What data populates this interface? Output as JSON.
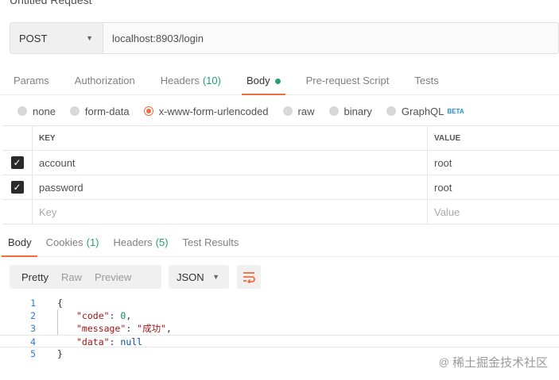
{
  "window": {
    "title": "Untitled Request"
  },
  "request": {
    "method": "POST",
    "url": "localhost:8903/login"
  },
  "request_tabs": [
    {
      "label": "Params"
    },
    {
      "label": "Authorization"
    },
    {
      "label": "Headers",
      "count": "(10)"
    },
    {
      "label": "Body"
    },
    {
      "label": "Pre-request Script"
    },
    {
      "label": "Tests"
    }
  ],
  "body_types": [
    {
      "label": "none"
    },
    {
      "label": "form-data"
    },
    {
      "label": "x-www-form-urlencoded",
      "selected": true
    },
    {
      "label": "raw"
    },
    {
      "label": "binary"
    },
    {
      "label": "GraphQL",
      "badge": "BETA"
    }
  ],
  "kv_table": {
    "headers": {
      "key": "KEY",
      "value": "VALUE"
    },
    "rows": [
      {
        "key": "account",
        "value": "root",
        "checked": true
      },
      {
        "key": "password",
        "value": "root",
        "checked": true
      }
    ],
    "placeholder": {
      "key": "Key",
      "value": "Value"
    }
  },
  "response_tabs": [
    {
      "label": "Body"
    },
    {
      "label": "Cookies",
      "count": "(1)"
    },
    {
      "label": "Headers",
      "count": "(5)"
    },
    {
      "label": "Test Results"
    }
  ],
  "response_view": {
    "modes": [
      "Pretty",
      "Raw",
      "Preview"
    ],
    "format": "JSON"
  },
  "response_body": {
    "line_numbers": [
      "1",
      "2",
      "3",
      "4",
      "5"
    ],
    "open": "{",
    "close": "}",
    "fields": [
      {
        "key": "\"code\"",
        "value": "0",
        "sep": ": ",
        "end": ","
      },
      {
        "key": "\"message\"",
        "value": "\"成功\"",
        "sep": ": ",
        "end": ","
      },
      {
        "key": "\"data\"",
        "value": "null",
        "sep": ": ",
        "end": ""
      }
    ]
  },
  "watermark": {
    "text": "稀土掘金技术社区",
    "symbol": "@"
  },
  "colors": {
    "accent": "#f26b3a",
    "green": "#25a07a"
  }
}
